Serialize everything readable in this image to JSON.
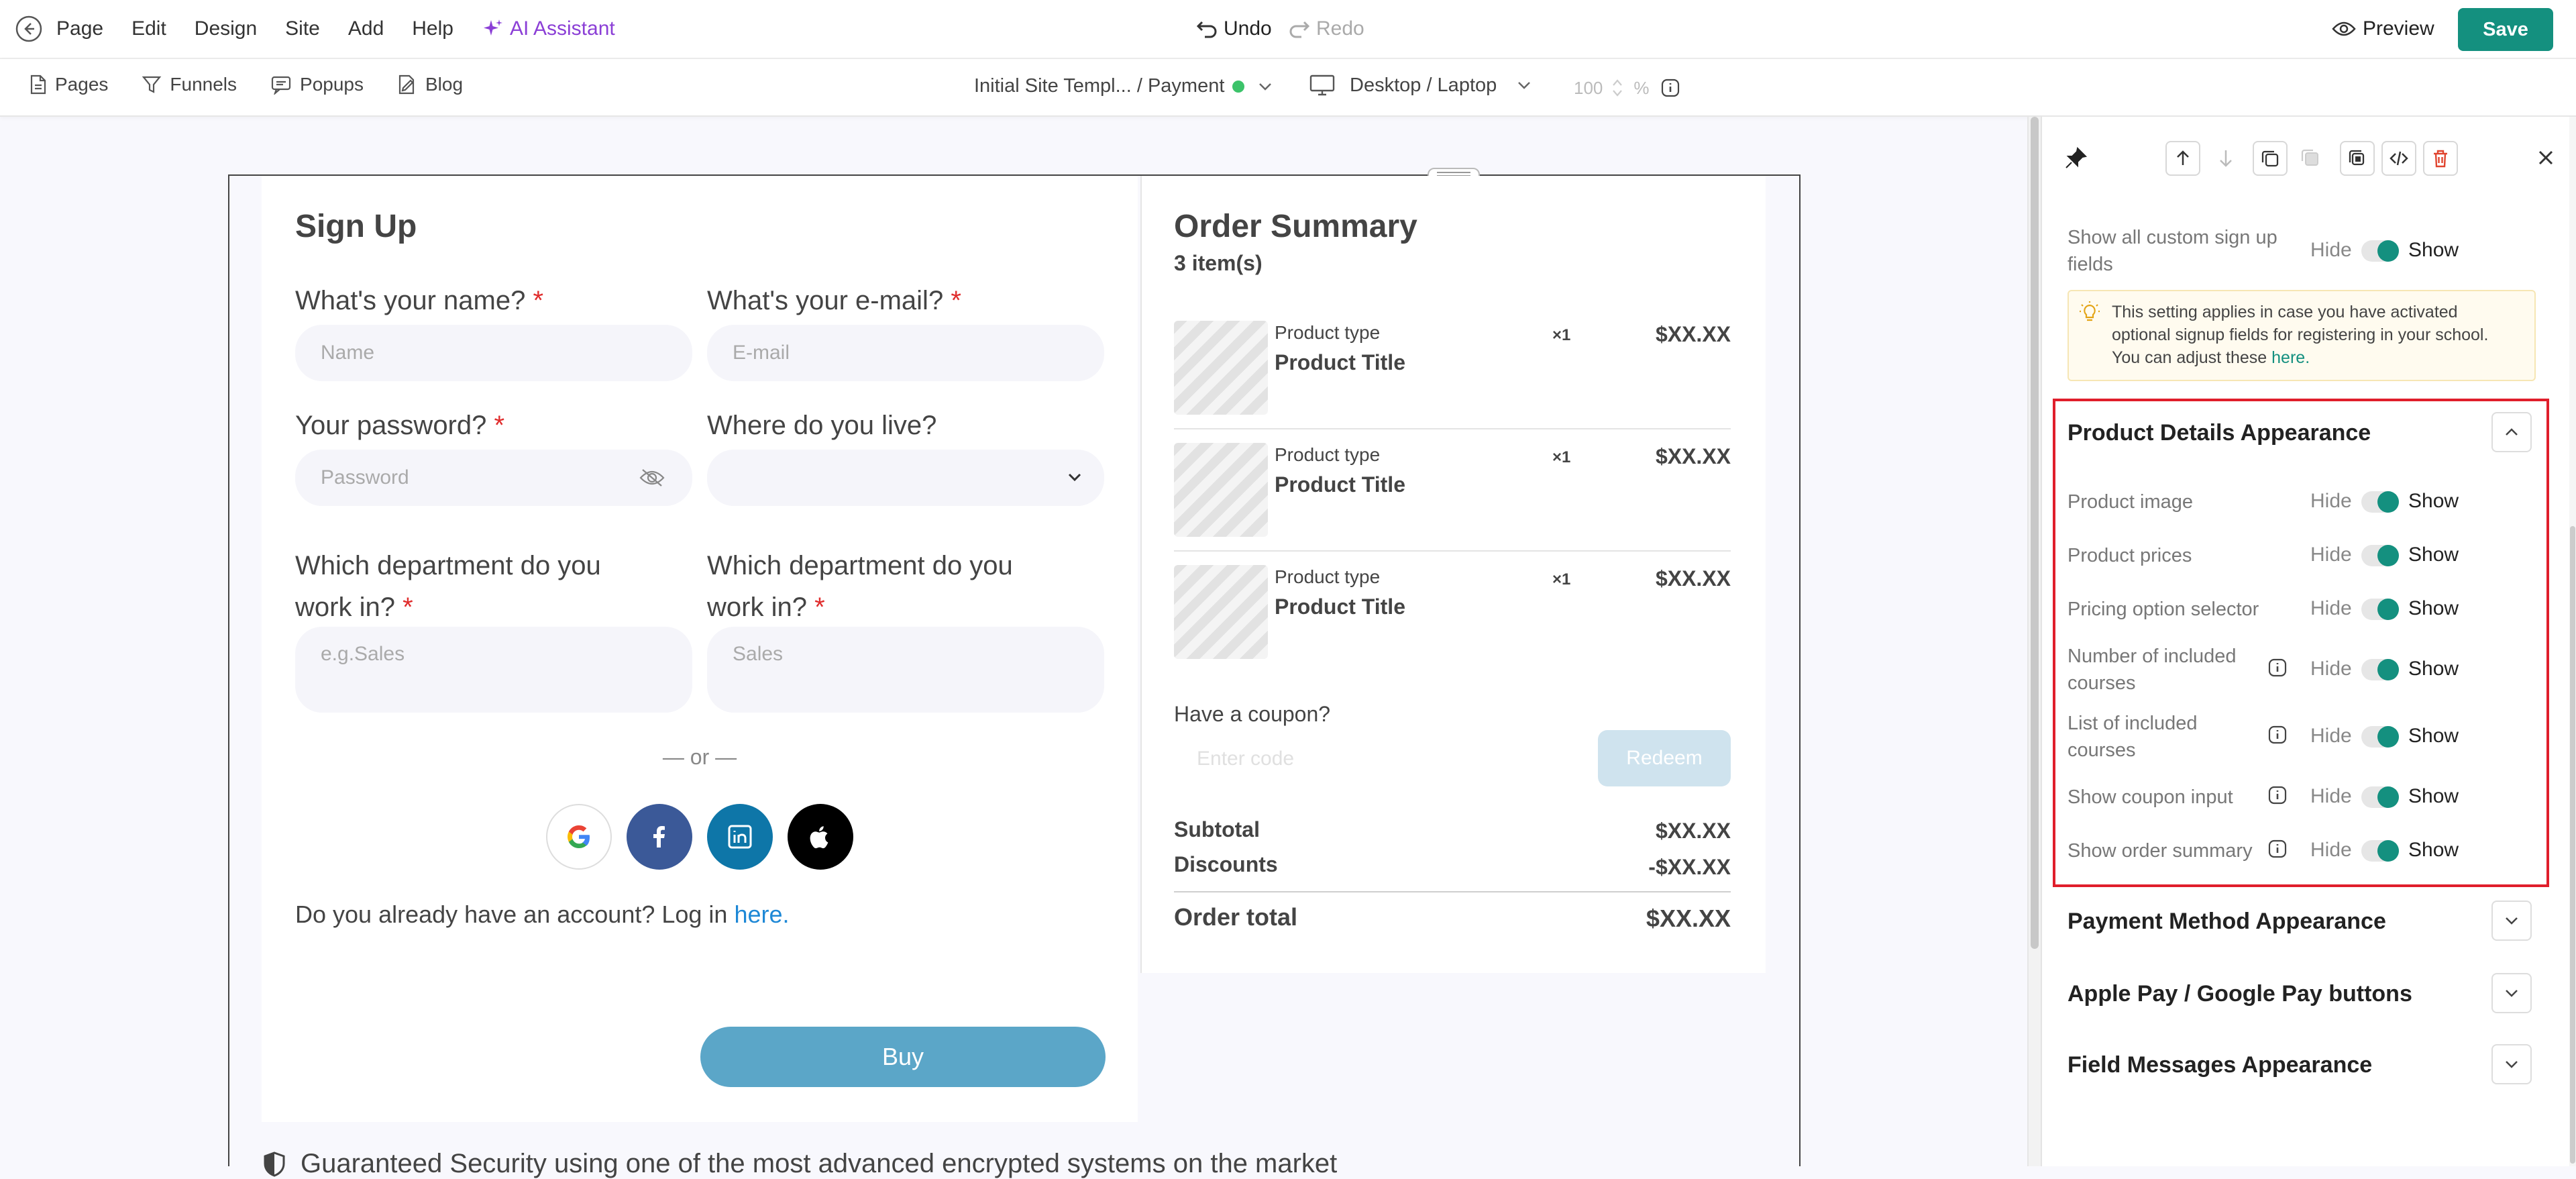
{
  "menu": {
    "items": [
      "Page",
      "Edit",
      "Design",
      "Site",
      "Add",
      "Help"
    ],
    "ai_assistant": "AI Assistant",
    "undo": "Undo",
    "redo": "Redo",
    "preview": "Preview",
    "save": "Save"
  },
  "nav": {
    "pages": "Pages",
    "funnels": "Funnels",
    "popups": "Popups",
    "blog": "Blog",
    "breadcrumb": "Initial Site Templ... / Payment",
    "device": "Desktop / Laptop",
    "zoom": "100",
    "zoom_unit": "%"
  },
  "signup": {
    "title": "Sign Up",
    "name_label": "What's your name?",
    "name_placeholder": "Name",
    "email_label": "What's your e-mail?",
    "email_placeholder": "E-mail",
    "password_label": "Your password?",
    "password_placeholder": "Password",
    "live_label": "Where do you live?",
    "dept_label_1_line1": "Which department do you",
    "dept_label_1_line2": "work in?",
    "dept_placeholder_1": "e.g.Sales",
    "dept_label_2_line1": "Which department do you",
    "dept_label_2_line2": "work in?",
    "dept_placeholder_2": "Sales",
    "required_mark": "*",
    "or_text": "— or —",
    "account_text": "Do you already have an account? Log in",
    "account_link": "here.",
    "buy": "Buy",
    "security_text": "Guaranteed Security using one of the most advanced encrypted systems on the market"
  },
  "order": {
    "title": "Order Summary",
    "items_count": "3 item(s)",
    "products": [
      {
        "type": "Product type",
        "title": "Product Title",
        "qty": "×1",
        "price": "$XX.XX"
      },
      {
        "type": "Product type",
        "title": "Product Title",
        "qty": "×1",
        "price": "$XX.XX"
      },
      {
        "type": "Product type",
        "title": "Product Title",
        "qty": "×1",
        "price": "$XX.XX"
      }
    ],
    "coupon_label": "Have a coupon?",
    "coupon_placeholder": "Enter code",
    "redeem": "Redeem",
    "subtotal_label": "Subtotal",
    "subtotal_value": "$XX.XX",
    "discounts_label": "Discounts",
    "discounts_value": "-$XX.XX",
    "total_label": "Order total",
    "total_value": "$XX.XX"
  },
  "panel": {
    "custom_fields_label_line1": "Show all custom sign up",
    "custom_fields_label_line2": "fields",
    "hide": "Hide",
    "show": "Show",
    "notice_line1": "This setting applies in case you have activated",
    "notice_line2": "optional signup fields for registering in your school.",
    "notice_line3": "You can adjust these",
    "notice_link": "here.",
    "product_section": "Product Details Appearance",
    "rows": [
      {
        "line1": "Product image",
        "line2": ""
      },
      {
        "line1": "Product prices",
        "line2": ""
      },
      {
        "line1": "Pricing option selector",
        "line2": ""
      },
      {
        "line1": "Number of included",
        "line2": "courses"
      },
      {
        "line1": "List of included",
        "line2": "courses"
      },
      {
        "line1": "Show coupon input",
        "line2": ""
      },
      {
        "line1": "Show order summary",
        "line2": ""
      }
    ],
    "payment_section": "Payment Method Appearance",
    "applepay_section": "Apple Pay / Google Pay buttons",
    "field_messages_section": "Field Messages Appearance"
  },
  "colors": {
    "accent": "#14907f",
    "highlight": "#e01e2b",
    "buy_button": "#5ba6c8",
    "ai_purple": "#8b3fd6"
  }
}
